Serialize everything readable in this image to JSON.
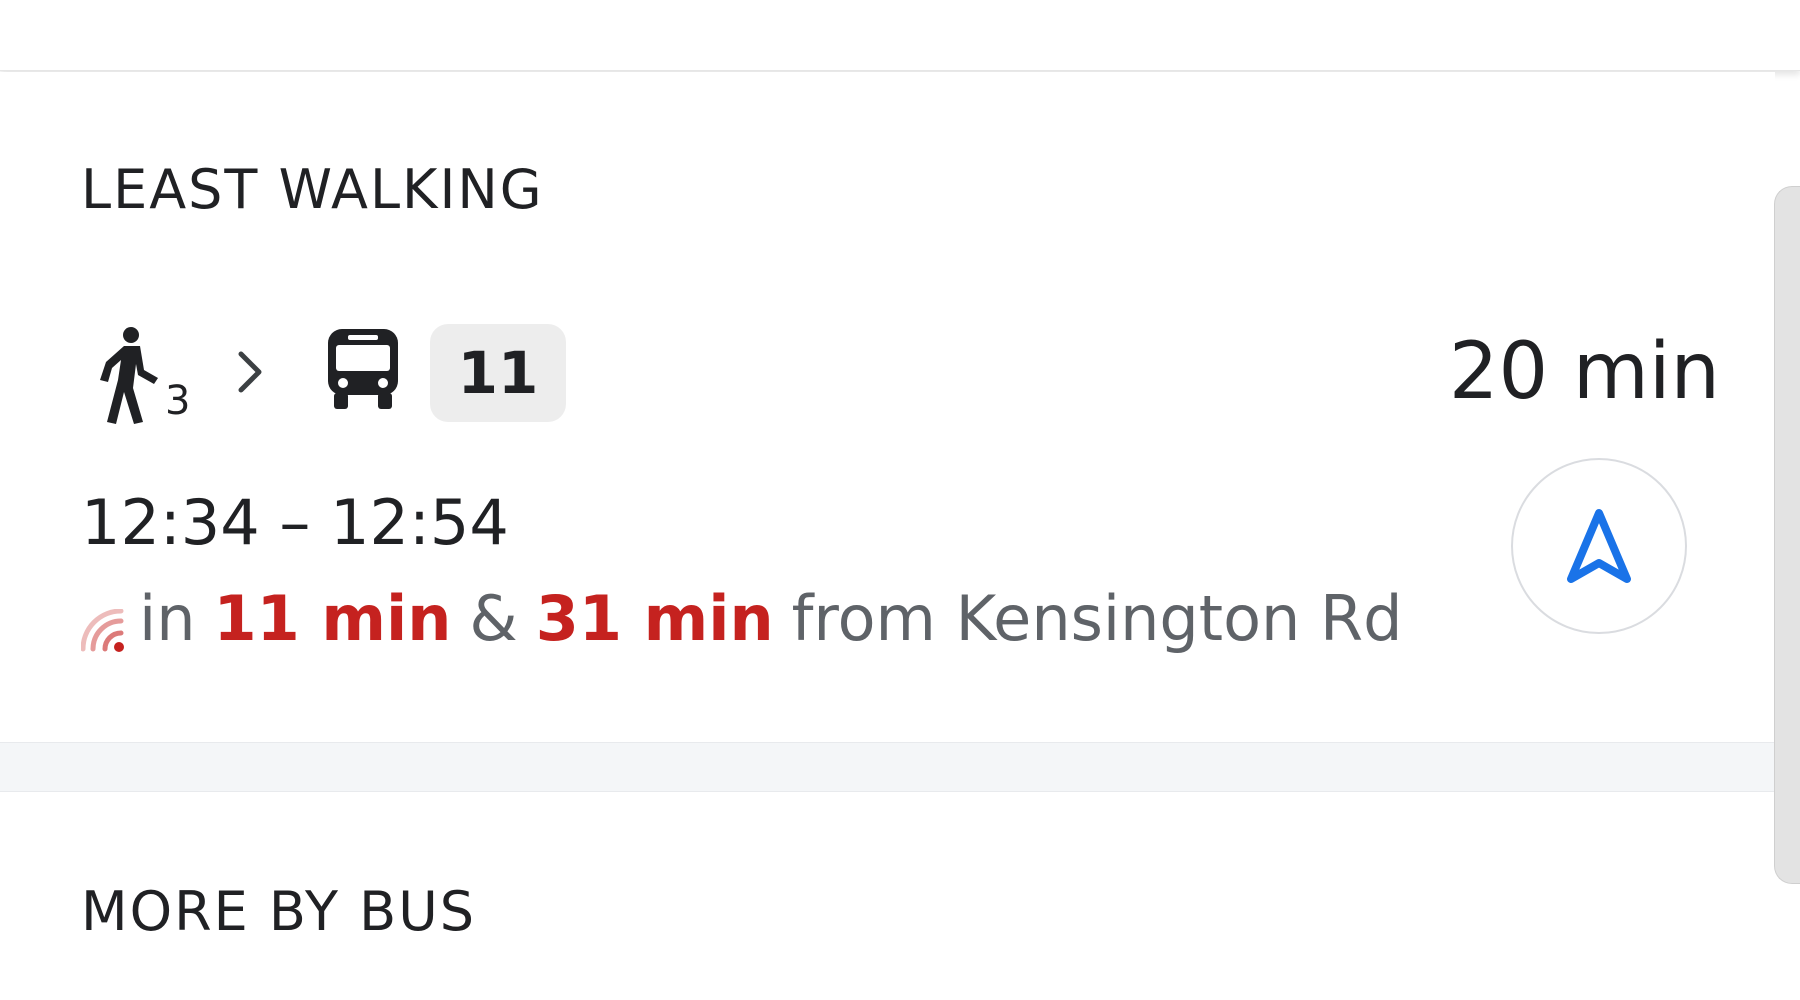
{
  "sections": {
    "least_walking": {
      "title": "LEAST WALKING",
      "route": {
        "walk_minutes": "3",
        "bus_route": "11",
        "duration": "20 min",
        "depart_arrive": "12:34 – 12:54",
        "realtime": {
          "prefix": "in",
          "first": "11 min",
          "joiner": "&",
          "second": "31 min",
          "suffix": "from Kensington Rd"
        }
      }
    },
    "more_by_bus": {
      "title": "MORE BY BUS"
    }
  },
  "icons": {
    "walk": "walk-icon",
    "chevron": "chevron-right-icon",
    "bus": "bus-icon",
    "live": "live-feed-icon",
    "navigate": "navigation-arrow-icon"
  },
  "colors": {
    "realtime_red": "#c5221f",
    "navigate_blue": "#1a73e8"
  }
}
